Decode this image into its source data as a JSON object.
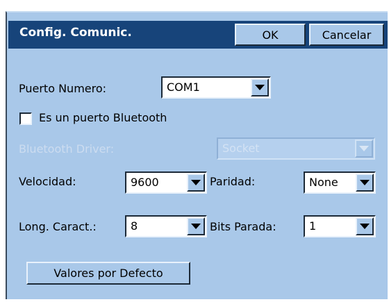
{
  "dialog": {
    "title": "Config. Comunic.",
    "ok_label": "OK",
    "cancel_label": "Cancelar"
  },
  "port": {
    "label": "Puerto Numero:",
    "value": "COM1"
  },
  "bluetooth_checkbox": {
    "label": "Es un puerto Bluetooth",
    "checked": false
  },
  "bluetooth_driver": {
    "label": "Bluetooth Driver:",
    "value": "Socket",
    "enabled": false
  },
  "speed": {
    "label": "Velocidad:",
    "value": "9600"
  },
  "parity": {
    "label": "Paridad:",
    "value": "None"
  },
  "char_length": {
    "label": "Long. Caract.:",
    "value": "8"
  },
  "stop_bits": {
    "label": "Bits Parada:",
    "value": "1"
  },
  "defaults_button": {
    "label": "Valores por Defecto"
  },
  "colors": {
    "title_bar": "#17447a",
    "dialog_bg": "#a9c8e9",
    "disabled_text": "#ccdcf0"
  }
}
